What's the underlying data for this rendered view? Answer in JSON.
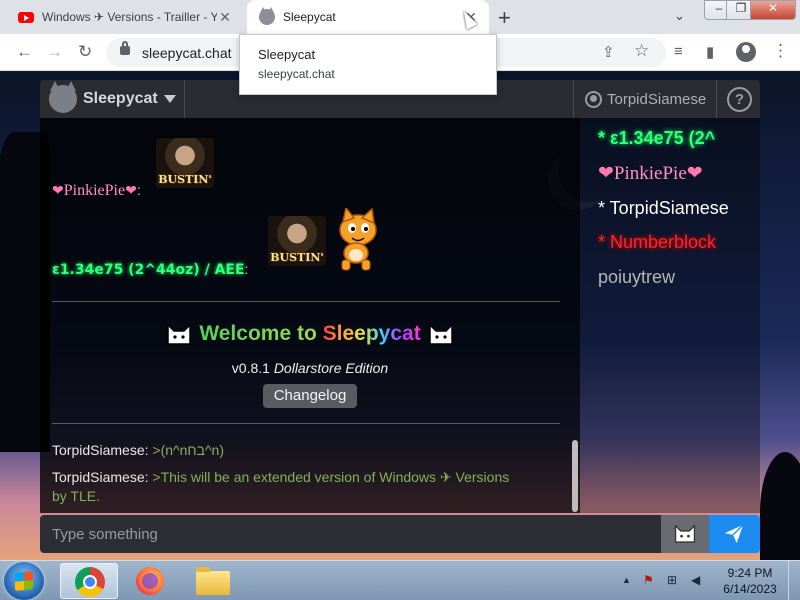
{
  "browser": {
    "tabs": [
      {
        "title": "Windows ✈ Versions - Trailler - Yo",
        "icon": "youtube-icon",
        "active": false
      },
      {
        "title": "Sleepycat",
        "icon": "sleepycat-favicon",
        "active": true
      }
    ],
    "close_symbol": "✕",
    "new_tab_symbol": "+",
    "tab_menu_symbol": "⌄",
    "window_controls": {
      "minimize": "–",
      "maximize": "❐",
      "close": "✕"
    },
    "nav": {
      "back": "←",
      "forward": "→",
      "reload": "↻"
    },
    "url": "sleepycat.chat",
    "toolbar_icons": {
      "share": "⇪",
      "bookmark": "☆",
      "reading_list": "≡",
      "side_panel": "▮",
      "menu": "⋮"
    },
    "hover_card": {
      "title": "Sleepycat",
      "url": "sleepycat.chat"
    }
  },
  "app": {
    "brand": "Sleepycat",
    "current_user": "TorpidSiamese",
    "help_label": "?",
    "messages": [
      {
        "user": "PinkiePie",
        "sticker": "BUSTIN'"
      },
      {
        "user": "ε1.34e75 (2^44oz) / AEE",
        "sticker": "BUSTIN'",
        "extra": "scratch-cat"
      }
    ],
    "welcome": {
      "part1": "Welcome to",
      "part2": "Sleepycat",
      "version": "v0.8.1",
      "edition": "Dollarstore Edition",
      "changelog_label": "Changelog"
    },
    "chat": [
      {
        "user": "TorpidSiamese:",
        "text": ">(n^nבח^n)"
      },
      {
        "user": "TorpidSiamese:",
        "text": ">This will be an extended version of Windows ✈ Versions by TLE."
      }
    ],
    "online_users": [
      {
        "name": "* ε1.34e75 (2^",
        "color": "#33ff7a"
      },
      {
        "name": "PinkiePie",
        "color": "#ff8fc4"
      },
      {
        "name": "* TorpidSiamese",
        "color": "#ffffff"
      },
      {
        "name": "* Numberblock",
        "color": "#ff2424"
      },
      {
        "name": "poiuytrew",
        "color": "#b6b6b6"
      }
    ],
    "input_placeholder": "Type something"
  },
  "taskbar": {
    "apps": [
      "chrome-icon",
      "firefox-icon",
      "explorer-folder-icon"
    ],
    "tray_symbols": {
      "expand": "▲",
      "flag": "⚑",
      "network": "⊞",
      "volume": "◀"
    },
    "time": "9:24 PM",
    "date": "6/14/2023"
  }
}
